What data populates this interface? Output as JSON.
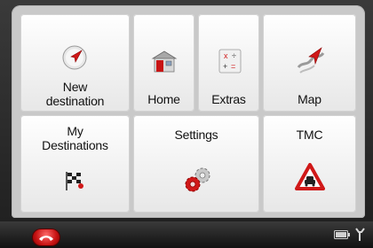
{
  "menu": {
    "new_destination": {
      "line1": "New",
      "line2": "destination",
      "icon": "navigation-arrow-icon"
    },
    "home": {
      "label": "Home",
      "icon": "home-icon"
    },
    "extras": {
      "label": "Extras",
      "icon": "extras-icon"
    },
    "map": {
      "label": "Map",
      "icon": "map-icon"
    },
    "my_destinations": {
      "line1": "My",
      "line2": "Destinations",
      "icon": "checkered-flag-icon"
    },
    "settings": {
      "label": "Settings",
      "icon": "gears-icon"
    },
    "tmc": {
      "label": "TMC",
      "icon": "traffic-warning-icon"
    }
  },
  "status_bar": {
    "back_icon": "phone-hangup-icon",
    "battery_icon": "battery-icon",
    "tool_icon": "wrench-icon"
  },
  "colors": {
    "accent_red": "#d01818",
    "panel_bg": "#c9c9c9",
    "bar_bg": "#1e1e1e"
  }
}
